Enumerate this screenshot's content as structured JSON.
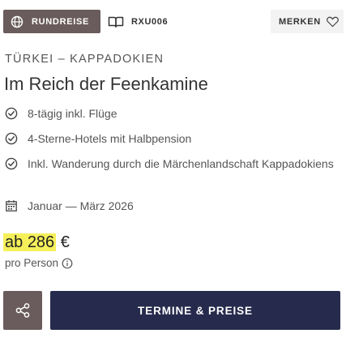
{
  "header": {
    "badge_label": "RUNDREISE",
    "trip_code": "RXU006",
    "bookmark_label": "MERKEN"
  },
  "trip": {
    "region": "TÜRKEI – KAPPADOKIEN",
    "title": "Im Reich der Feenkamine",
    "features": [
      {
        "icon": "check-circle-icon",
        "text": "8-tägig inkl. Flüge"
      },
      {
        "icon": "check-circle-icon",
        "text": "4-Sterne-Hotels mit Halbpension"
      },
      {
        "icon": "check-circle-icon",
        "text": "Inkl. Wanderung durch die Märchenlandschaft Kappadokiens"
      }
    ],
    "dates": {
      "icon": "calendar-icon",
      "text": "Januar — März 2026"
    }
  },
  "price": {
    "prefix": "ab",
    "amount": "286",
    "currency": "€",
    "per_person": "pro Person"
  },
  "actions": {
    "share_icon": "share-icon",
    "cta_label": "TERMINE & PREISE"
  },
  "colors": {
    "badge_bg": "#6a5c5c",
    "cta_bg": "#262b4d",
    "highlight": "#f5f05a",
    "bookmark_bg": "#f3f3f3"
  }
}
